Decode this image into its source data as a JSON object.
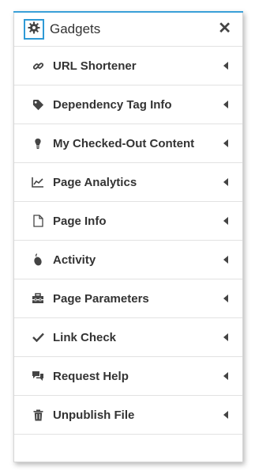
{
  "header": {
    "title": "Gadgets",
    "close_symbol": "✕"
  },
  "items": [
    {
      "label": "URL Shortener",
      "icon": "link-icon"
    },
    {
      "label": "Dependency Tag Info",
      "icon": "tag-icon"
    },
    {
      "label": "My Checked-Out Content",
      "icon": "lightbulb-icon"
    },
    {
      "label": "Page Analytics",
      "icon": "line-chart-icon"
    },
    {
      "label": "Page Info",
      "icon": "document-icon"
    },
    {
      "label": "Activity",
      "icon": "mouse-icon"
    },
    {
      "label": "Page Parameters",
      "icon": "toolbox-icon"
    },
    {
      "label": "Link Check",
      "icon": "checkmark-icon"
    },
    {
      "label": "Request Help",
      "icon": "chat-icon"
    },
    {
      "label": "Unpublish File",
      "icon": "trash-icon"
    }
  ],
  "colors": {
    "accent": "#2f9ad6",
    "text": "#333333",
    "divider": "#e2e2e2"
  }
}
